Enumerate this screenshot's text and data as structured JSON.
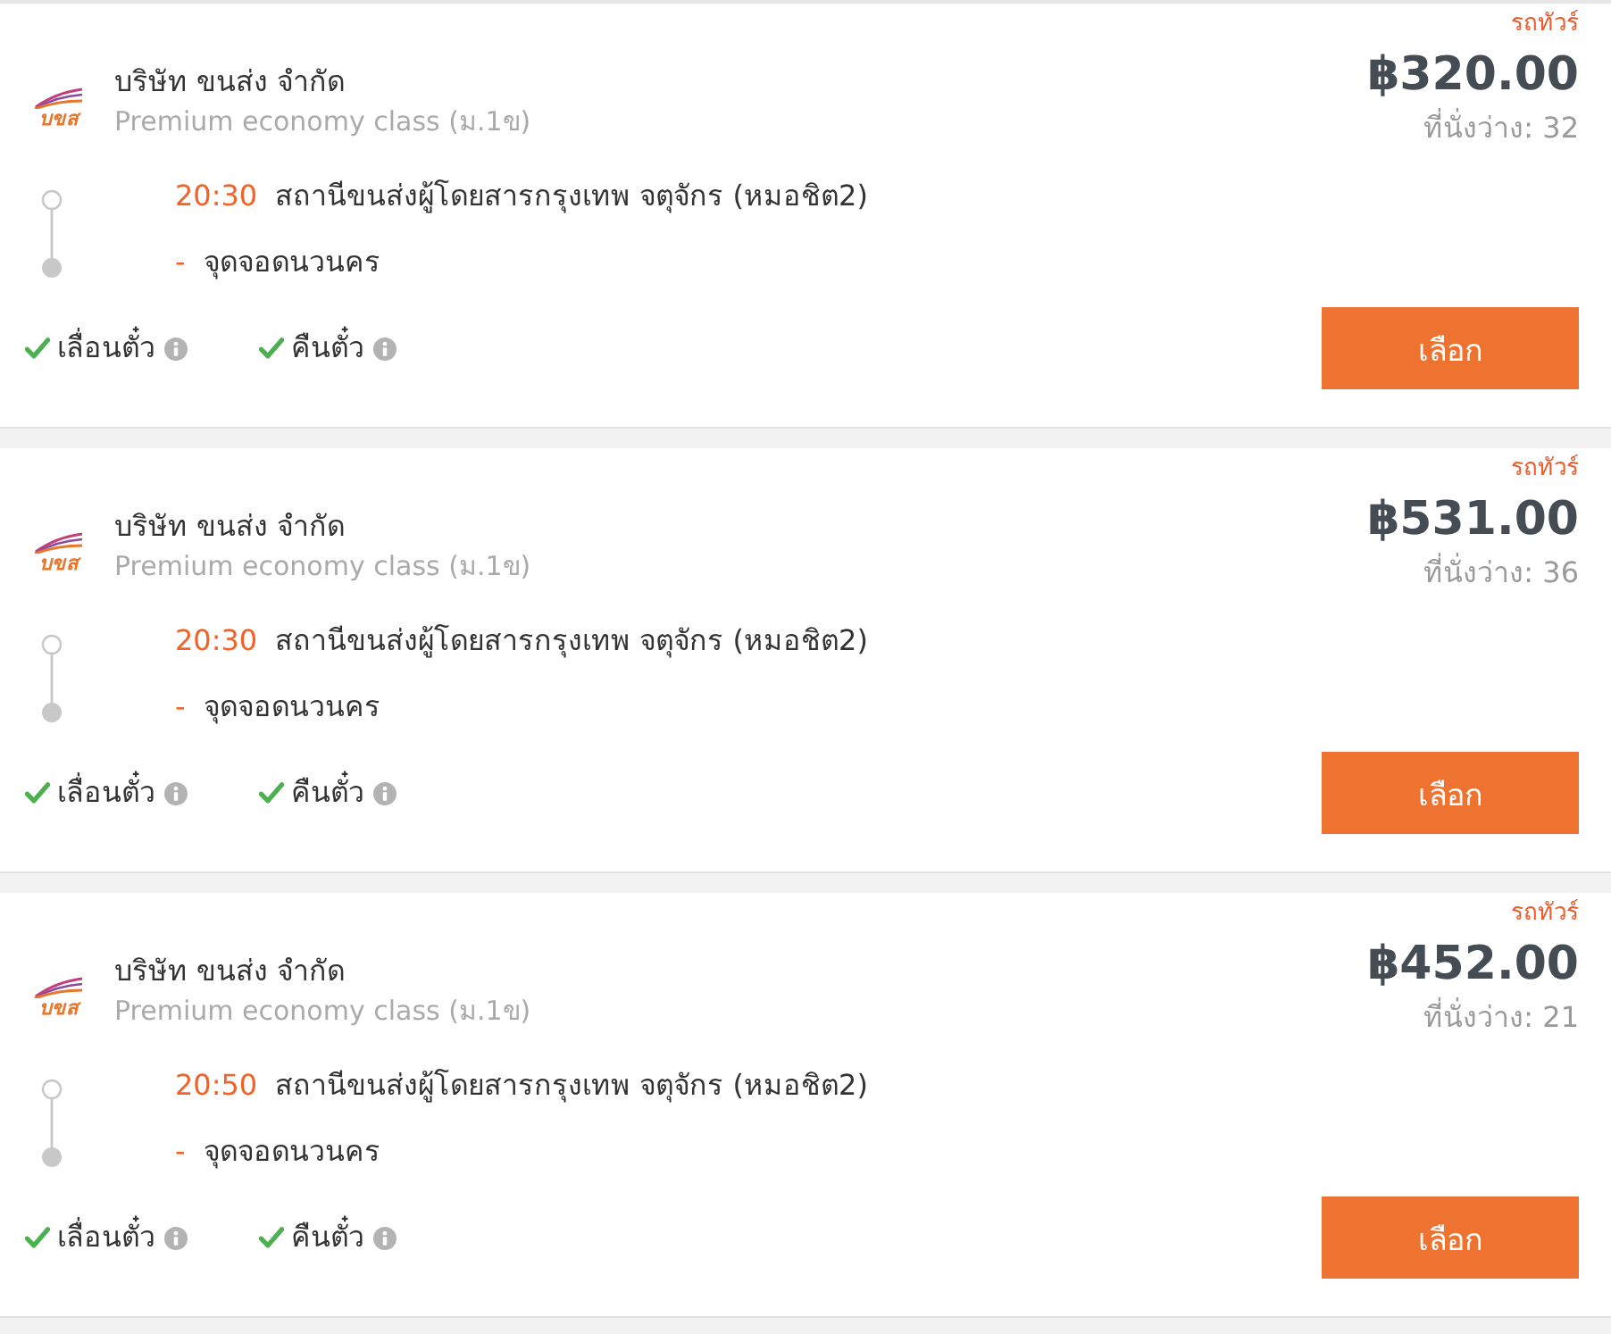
{
  "trips": [
    {
      "badge": "รถทัวร์",
      "logo_text": "บขส",
      "operator": "บริษัท ขนส่ง จำกัด",
      "service_class": "Premium economy class (ม.1ข)",
      "price": "฿320.00",
      "seats": "ที่นั่งว่าง: 32",
      "route": [
        {
          "time": "20:30",
          "place": "สถานีขนส่งผู้โดยสารกรุงเทพ จตุจักร (หมอชิต2)"
        },
        {
          "time": "-",
          "place": "จุดจอดนวนคร"
        }
      ],
      "policies": [
        {
          "label": "เลื่อนตั๋ว",
          "allowed": true
        },
        {
          "label": "คืนตั๋ว",
          "allowed": true
        }
      ],
      "button": "เลือก"
    },
    {
      "badge": "รถทัวร์",
      "logo_text": "บขส",
      "operator": "บริษัท ขนส่ง จำกัด",
      "service_class": "Premium economy class (ม.1ข)",
      "price": "฿531.00",
      "seats": "ที่นั่งว่าง: 36",
      "route": [
        {
          "time": "20:30",
          "place": "สถานีขนส่งผู้โดยสารกรุงเทพ จตุจักร (หมอชิต2)"
        },
        {
          "time": "-",
          "place": "จุดจอดนวนคร"
        }
      ],
      "policies": [
        {
          "label": "เลื่อนตั๋ว",
          "allowed": true
        },
        {
          "label": "คืนตั๋ว",
          "allowed": true
        }
      ],
      "button": "เลือก"
    },
    {
      "badge": "รถทัวร์",
      "logo_text": "บขส",
      "operator": "บริษัท ขนส่ง จำกัด",
      "service_class": "Premium economy class (ม.1ข)",
      "price": "฿452.00",
      "seats": "ที่นั่งว่าง: 21",
      "route": [
        {
          "time": "20:50",
          "place": "สถานีขนส่งผู้โดยสารกรุงเทพ จตุจักร (หมอชิต2)"
        },
        {
          "time": "-",
          "place": "จุดจอดนวนคร"
        }
      ],
      "policies": [
        {
          "label": "เลื่อนตั๋ว",
          "allowed": true
        },
        {
          "label": "คืนตั๋ว",
          "allowed": true
        }
      ],
      "button": "เลือก"
    }
  ]
}
